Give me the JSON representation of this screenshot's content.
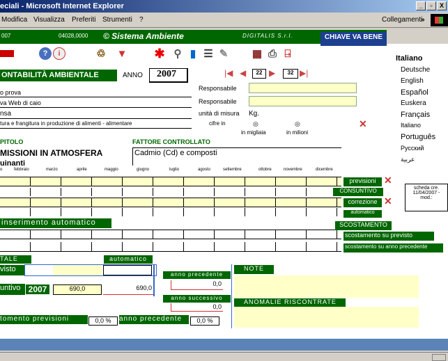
{
  "window": {
    "title": "eciali - Microsoft Internet Explorer",
    "min": "_",
    "max": "&",
    "close": "X"
  },
  "menu": {
    "items": [
      "Modifica",
      "Visualizza",
      "Preferiti",
      "Strumenti",
      "?"
    ],
    "links_label": "Collegamenti",
    "links_arrow": "»"
  },
  "header": {
    "code_left": "007",
    "code_mid": "04028,0000",
    "brand": "© Sistema Ambiente",
    "company": "DIGITALIS S.r.l.",
    "key_label": "CHIAVE VA BENE"
  },
  "languages": {
    "selected": "Italiano",
    "items": [
      "Deutsche",
      "English",
      "Español",
      "Euskera",
      "Français",
      "Italiano",
      "Português",
      "Русский",
      "عربية"
    ]
  },
  "section": {
    "title": "ONTABILITÀ AMBIENTALE",
    "anno_label": "ANNO",
    "anno_value": "2007",
    "nav_a": "22",
    "nav_b": "32"
  },
  "info": {
    "rows": [
      "o prova",
      "va Web di caio",
      "nsa",
      "tura e frangitura in produzione di alimenti - alimentare"
    ],
    "responsabile_1": "Responsabile",
    "responsabile_2": "Responsabile",
    "unita_label": "unità di misura",
    "unita_value": "Kg.",
    "cifre_label": "cifre in",
    "migliaia": "in migliaia",
    "milioni": "in milioni"
  },
  "capitolo": {
    "label": "PITOLO",
    "value": "MISSIONI IN ATMOSFERA",
    "sub": "uinanti"
  },
  "fattore": {
    "label": "FATTORE CONTROLLATO",
    "value": "Cadmio (Cd) e composti"
  },
  "months": [
    "o",
    "febbraio",
    "marzo",
    "aprile",
    "maggio",
    "giugno",
    "luglio",
    "agosto",
    "settembre",
    "ottobre",
    "novembre",
    "dicembre"
  ],
  "buttons": {
    "previsioni": "previsioni",
    "consuntivo": "CONSUNTIVO",
    "correzione": "correzione",
    "automatico": "automatico",
    "inserimento": "inserimento automatico",
    "scostamento": "SCOSTAMENTO",
    "scost_previsto": "scostamento su previsto",
    "scost_anno": "scostamento su anno precedente"
  },
  "scheda": {
    "line1": "scheda cre.",
    "line2": "11/04/2007 -",
    "line3": "mod.:"
  },
  "totals": {
    "tale": "TALE",
    "automatico2": "automatico",
    "visto": "visto",
    "untivo": "untivo",
    "year": "2007",
    "val1": "690,0",
    "val2": "690,0",
    "anno_prec": "anno precedente",
    "anno_prec_val": "0,0",
    "anno_succ": "anno successivo",
    "anno_succ_val": "0,0",
    "note": "NOTE",
    "anomalie": "ANOMALIE RISCONTRATE",
    "scost_prev_label": "tomento previsioni",
    "scost_prev_val": "0,0 %",
    "anno_prec2": "anno precedente",
    "anno_prec2_val": "0,0 %"
  }
}
